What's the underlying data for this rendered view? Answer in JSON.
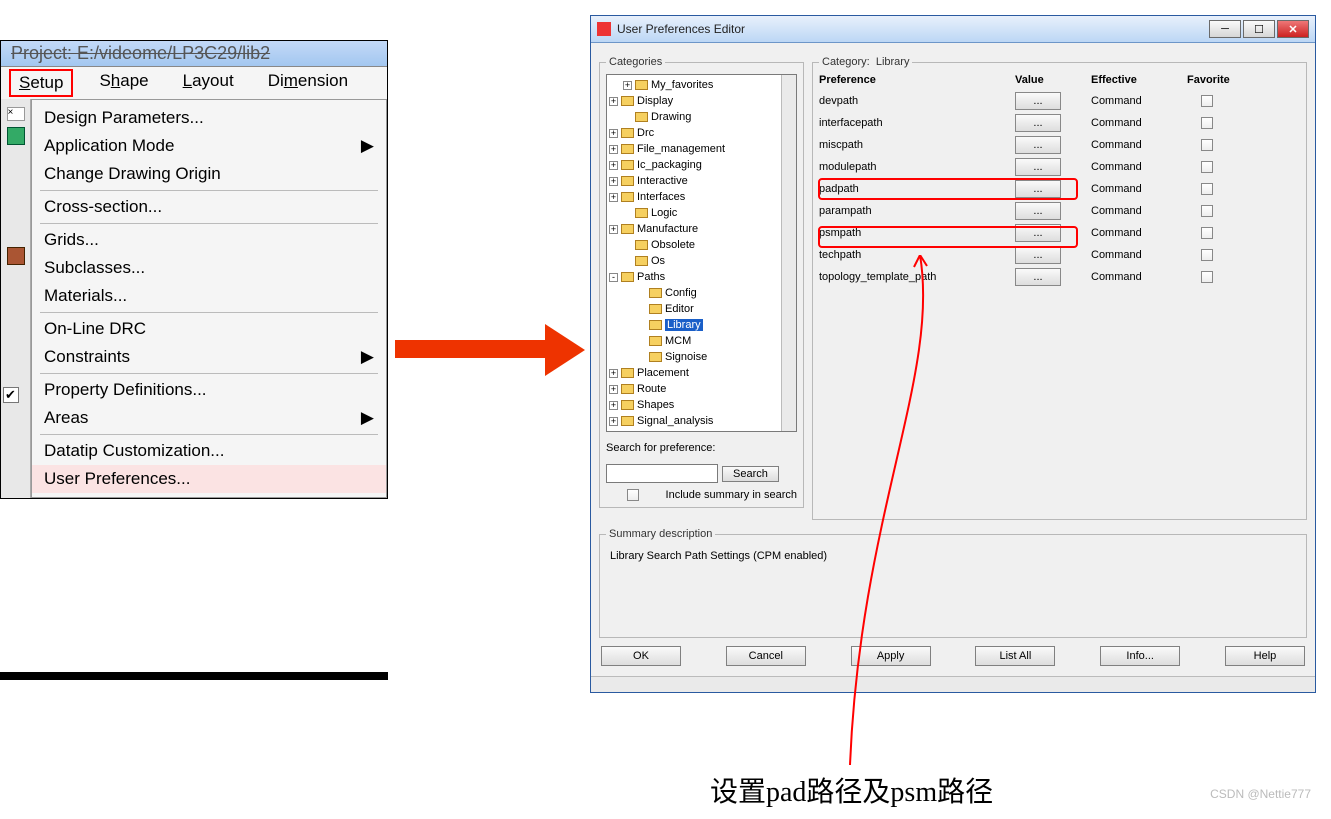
{
  "left": {
    "title_strikethrough": "Project: E:/videome/LP3C29/lib2",
    "menubar": [
      "Setup",
      "Shape",
      "Layout",
      "Dimension"
    ],
    "selected_menu_index": 0,
    "dropdown": {
      "items": [
        {
          "label": "Design Parameters...",
          "underline": "D"
        },
        {
          "label": "Application Mode",
          "underline": "A",
          "arrow": true
        },
        {
          "label": "Change Drawing Origin",
          "underline": "h"
        },
        {
          "label": "Cross-section...",
          "underline": "C"
        },
        {
          "label": "Grids...",
          "underline": "G"
        },
        {
          "label": "Subclasses...",
          "underline": "S"
        },
        {
          "label": "Materials...",
          "underline": "M"
        },
        {
          "label": "On-Line DRC",
          "checked": true
        },
        {
          "label": "Constraints",
          "underline": "o",
          "arrow": true
        },
        {
          "label": "Property Definitions...",
          "underline": "P"
        },
        {
          "label": "Areas",
          "underline": "A",
          "arrow": true
        },
        {
          "label": "Datatip Customization...",
          "underline": "D"
        },
        {
          "label": "User Preferences...",
          "underline": "U",
          "selected": true
        }
      ]
    }
  },
  "dialog": {
    "title": "User Preferences Editor",
    "categories_legend": "Categories",
    "category_legend": "Category:",
    "category_value": "Library",
    "tree": [
      {
        "pm": "+",
        "lbl": "My_favorites",
        "ind": 1
      },
      {
        "pm": "+",
        "lbl": "Display",
        "ind": 0
      },
      {
        "pm": "",
        "lbl": "Drawing",
        "ind": 1
      },
      {
        "pm": "+",
        "lbl": "Drc",
        "ind": 0
      },
      {
        "pm": "+",
        "lbl": "File_management",
        "ind": 0
      },
      {
        "pm": "+",
        "lbl": "Ic_packaging",
        "ind": 0
      },
      {
        "pm": "+",
        "lbl": "Interactive",
        "ind": 0
      },
      {
        "pm": "+",
        "lbl": "Interfaces",
        "ind": 0
      },
      {
        "pm": "",
        "lbl": "Logic",
        "ind": 1
      },
      {
        "pm": "+",
        "lbl": "Manufacture",
        "ind": 0
      },
      {
        "pm": "",
        "lbl": "Obsolete",
        "ind": 1
      },
      {
        "pm": "",
        "lbl": "Os",
        "ind": 1
      },
      {
        "pm": "-",
        "lbl": "Paths",
        "ind": 0
      },
      {
        "pm": "",
        "lbl": "Config",
        "ind": 2
      },
      {
        "pm": "",
        "lbl": "Editor",
        "ind": 2
      },
      {
        "pm": "",
        "lbl": "Library",
        "ind": 2,
        "sel": true
      },
      {
        "pm": "",
        "lbl": "MCM",
        "ind": 2
      },
      {
        "pm": "",
        "lbl": "Signoise",
        "ind": 2
      },
      {
        "pm": "+",
        "lbl": "Placement",
        "ind": 0
      },
      {
        "pm": "+",
        "lbl": "Route",
        "ind": 0
      },
      {
        "pm": "+",
        "lbl": "Shapes",
        "ind": 0
      },
      {
        "pm": "+",
        "lbl": "Signal_analysis",
        "ind": 0
      }
    ],
    "headers": {
      "pref": "Preference",
      "val": "Value",
      "eff": "Effective",
      "fav": "Favorite"
    },
    "prefs": [
      {
        "name": "devpath",
        "eff": "Command"
      },
      {
        "name": "interfacepath",
        "eff": "Command"
      },
      {
        "name": "miscpath",
        "eff": "Command"
      },
      {
        "name": "modulepath",
        "eff": "Command"
      },
      {
        "name": "padpath",
        "eff": "Command",
        "hl": true
      },
      {
        "name": "parampath",
        "eff": "Command"
      },
      {
        "name": "psmpath",
        "eff": "Command",
        "hl": true
      },
      {
        "name": "techpath",
        "eff": "Command"
      },
      {
        "name": "topology_template_path",
        "eff": "Command"
      }
    ],
    "val_btn": "...",
    "search_label": "Search for preference:",
    "search_btn": "Search",
    "include_label": "Include summary in search",
    "summary_legend": "Summary description",
    "summary_text": "Library Search Path Settings (CPM enabled)",
    "buttons": [
      "OK",
      "Cancel",
      "Apply",
      "List All",
      "Info...",
      "Help"
    ]
  },
  "caption": "设置pad路径及psm路径",
  "watermark": "CSDN @Nettie777"
}
